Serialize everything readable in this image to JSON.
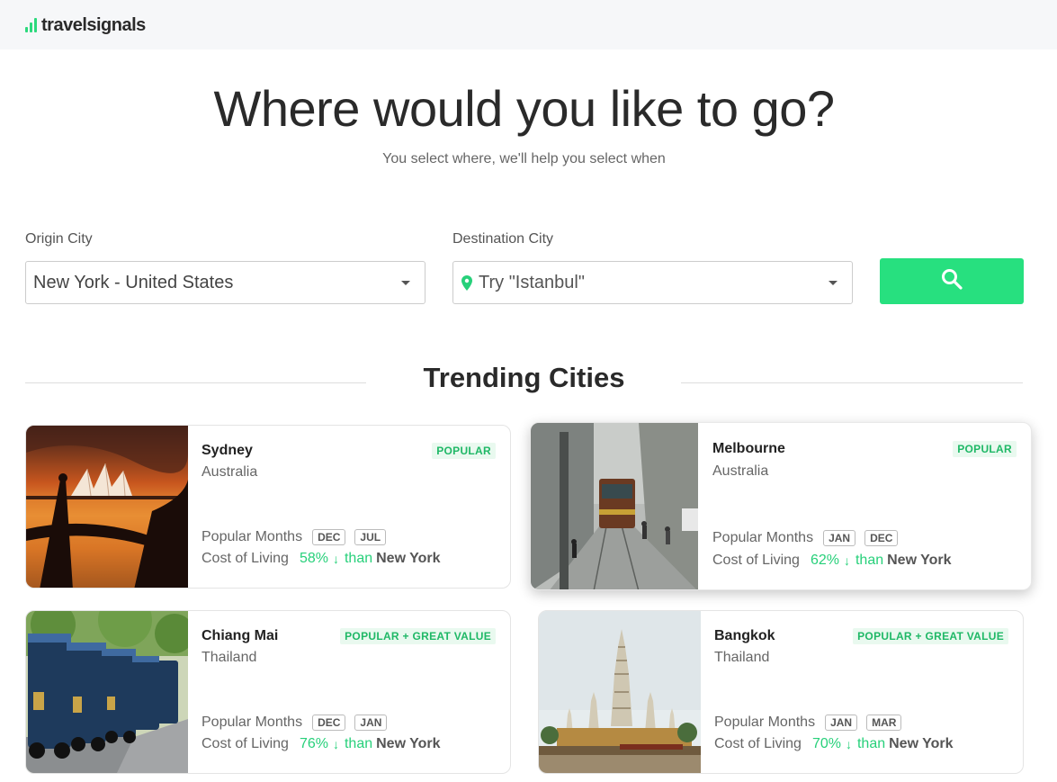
{
  "header": {
    "logo_text": "travelsignals",
    "brand_color": "#2bd97c"
  },
  "hero": {
    "title": "Where would you like to go?",
    "subtitle": "You select where, we'll help you select when"
  },
  "search": {
    "origin_label": "Origin City",
    "origin_value": "New York - United States",
    "destination_label": "Destination City",
    "destination_placeholder": "Try \"Istanbul\"",
    "button_icon": "search-icon",
    "button_color": "#27e07f"
  },
  "trending": {
    "title": "Trending Cities",
    "months_label": "Popular Months",
    "cost_label": "Cost of Living",
    "than_label": "than",
    "home_city": "New York",
    "cards": [
      {
        "city": "Sydney",
        "country": "Australia",
        "badge": "POPULAR",
        "months": [
          "DEC",
          "JUL"
        ],
        "cost_pct": "58%",
        "cost_direction": "down",
        "image": "sydney-opera-house-sunset"
      },
      {
        "city": "Melbourne",
        "country": "Australia",
        "badge": "POPULAR",
        "months": [
          "JAN",
          "DEC"
        ],
        "cost_pct": "62%",
        "cost_direction": "down",
        "image": "melbourne-tram-street"
      },
      {
        "city": "Chiang Mai",
        "country": "Thailand",
        "badge": "POPULAR + GREAT VALUE",
        "months": [
          "DEC",
          "JAN"
        ],
        "cost_pct": "76%",
        "cost_direction": "down",
        "image": "chiang-mai-tuk-tuks"
      },
      {
        "city": "Bangkok",
        "country": "Thailand",
        "badge": "POPULAR + GREAT VALUE",
        "months": [
          "JAN",
          "MAR"
        ],
        "cost_pct": "70%",
        "cost_direction": "down",
        "image": "bangkok-wat-arun"
      }
    ]
  }
}
